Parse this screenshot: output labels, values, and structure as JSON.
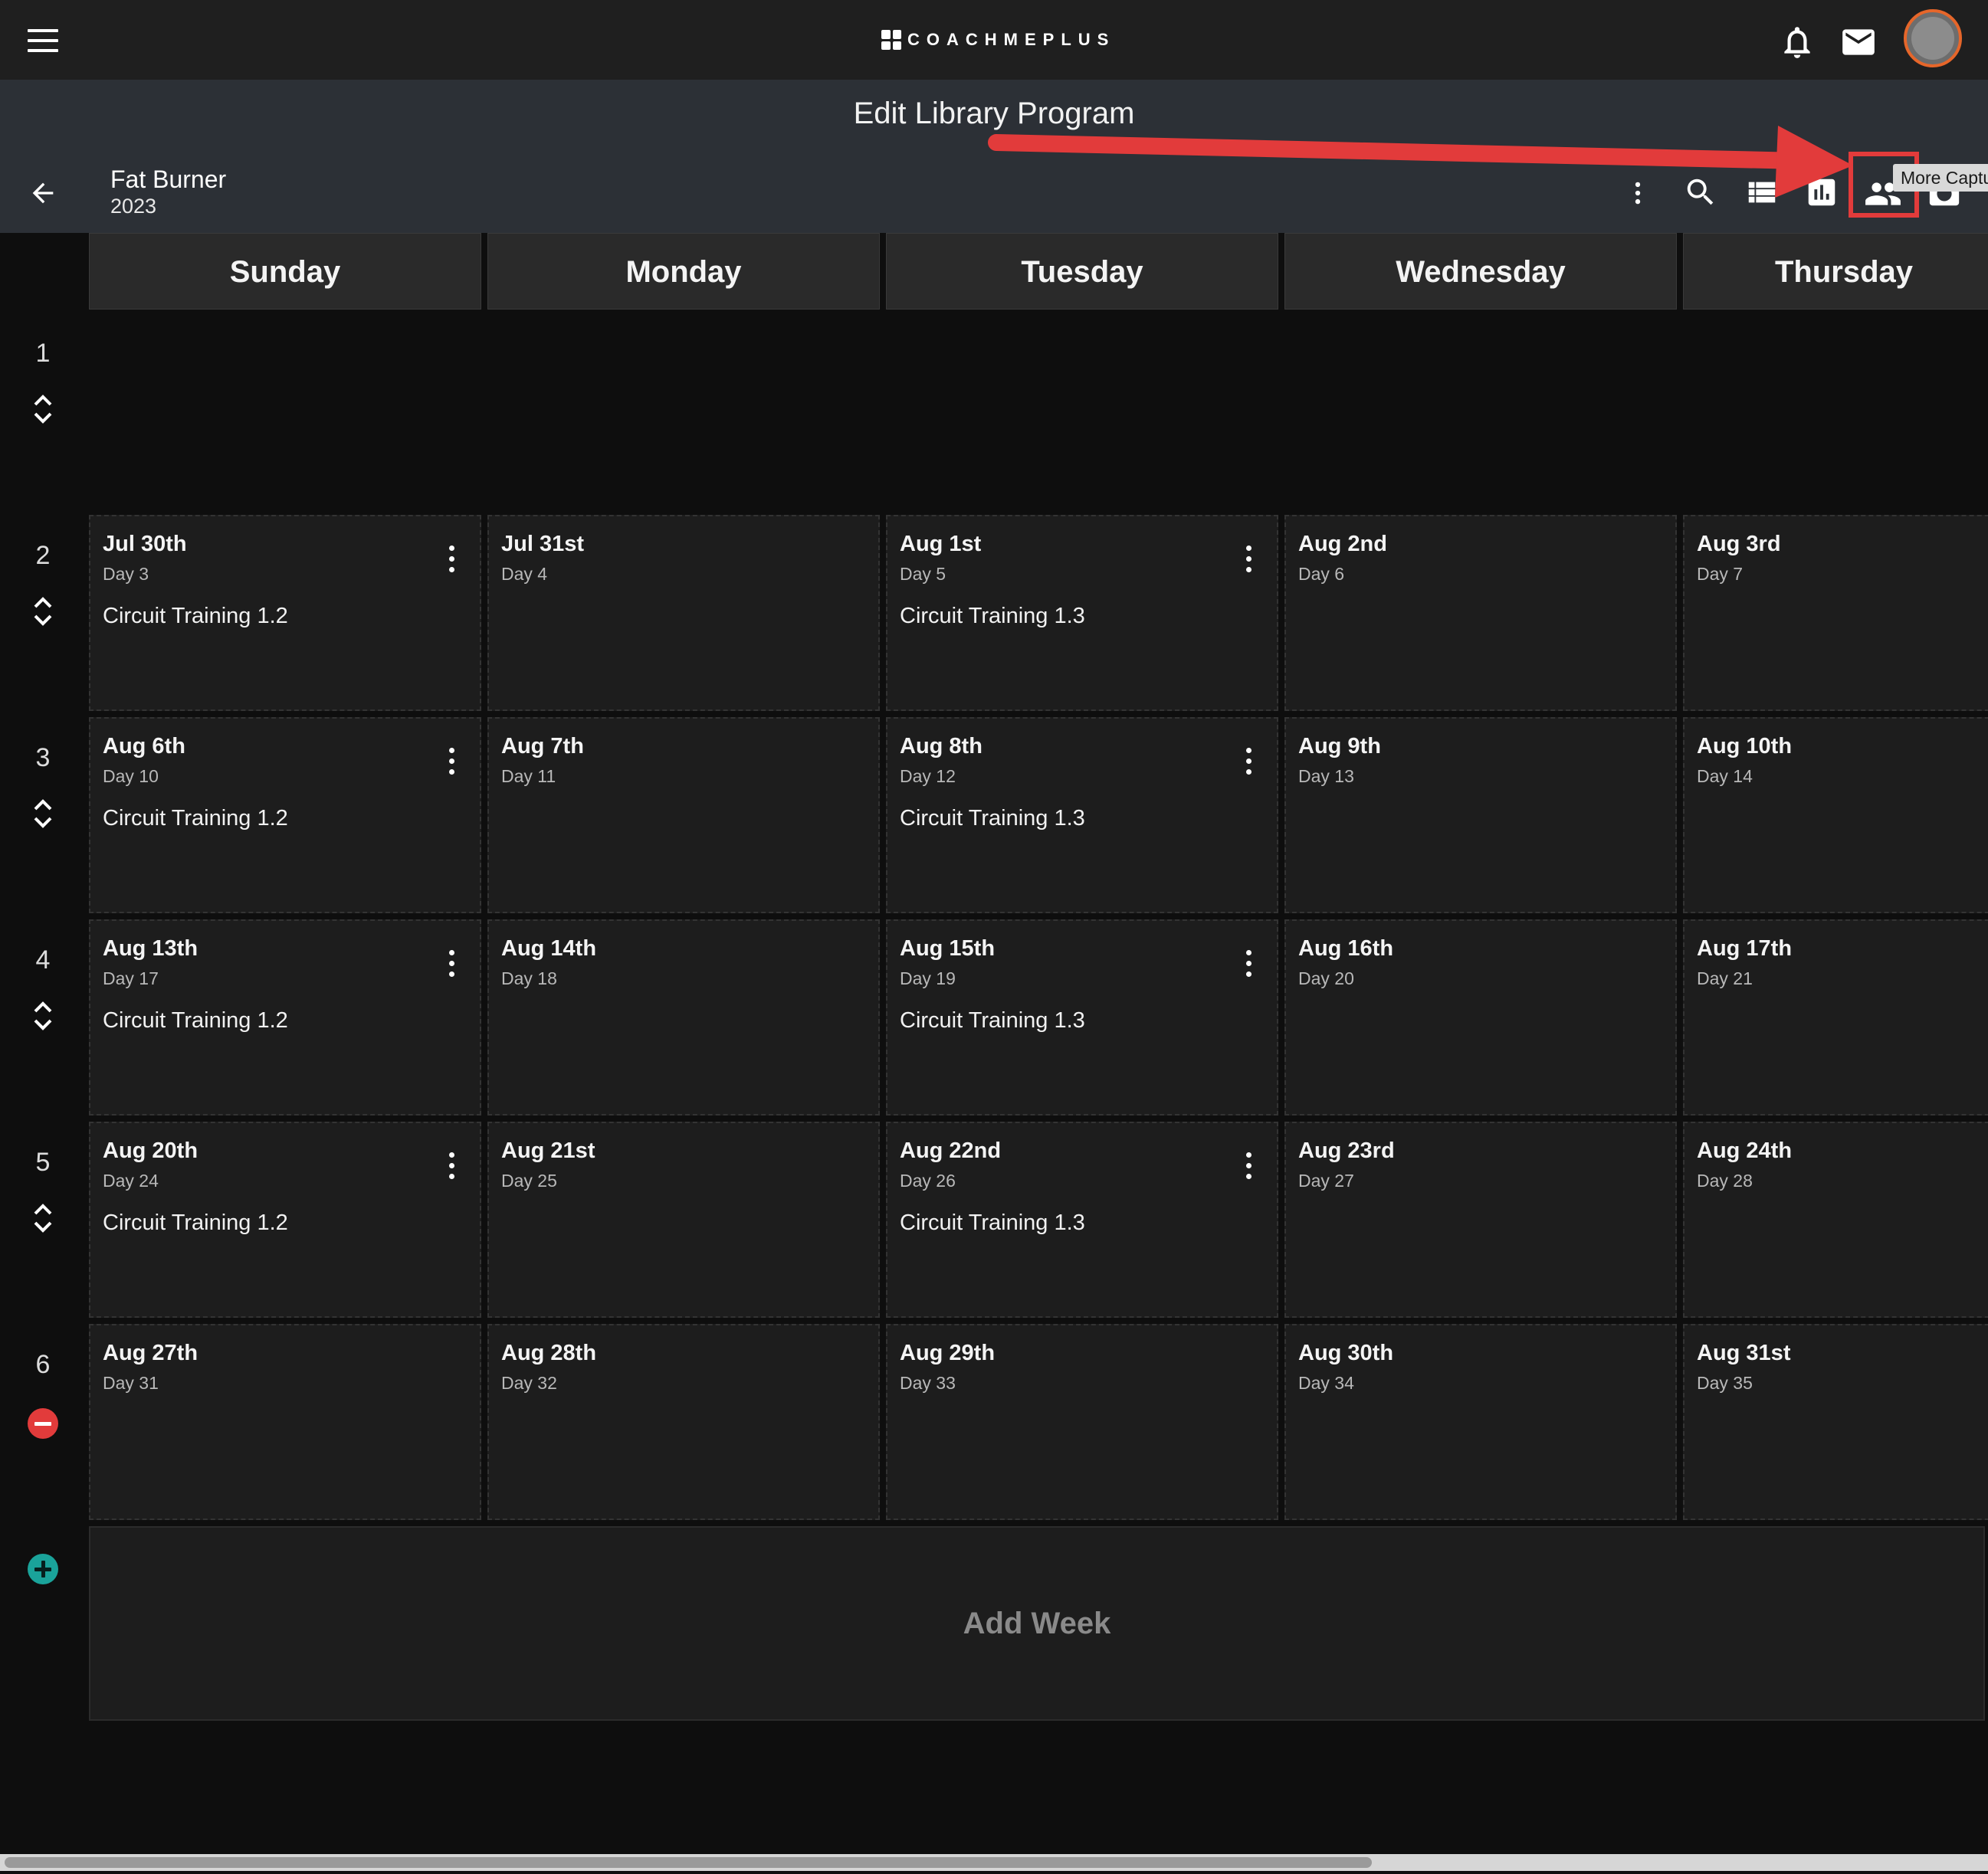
{
  "app": {
    "logo_text": "COACHMEPLUS"
  },
  "header": {
    "page_title": "Edit Library Program"
  },
  "program": {
    "name": "Fat Burner",
    "year": "2023"
  },
  "toolbar": {
    "tooltip": "More Captu"
  },
  "calendar": {
    "days": [
      "Sunday",
      "Monday",
      "Tuesday",
      "Wednesday",
      "Thursday"
    ],
    "weeks": [
      {
        "number": "1",
        "cells": []
      },
      {
        "number": "2",
        "cells": [
          {
            "date": "Jul 30th",
            "day": "Day 3",
            "workout": "Circuit Training 1.2"
          },
          {
            "date": "Jul 31st",
            "day": "Day 4",
            "workout": ""
          },
          {
            "date": "Aug 1st",
            "day": "Day 5",
            "workout": "Circuit Training 1.3"
          },
          {
            "date": "Aug 2nd",
            "day": "Day 6",
            "workout": ""
          },
          {
            "date": "Aug 3rd",
            "day": "Day 7",
            "workout": ""
          }
        ]
      },
      {
        "number": "3",
        "cells": [
          {
            "date": "Aug 6th",
            "day": "Day 10",
            "workout": "Circuit Training 1.2"
          },
          {
            "date": "Aug 7th",
            "day": "Day 11",
            "workout": ""
          },
          {
            "date": "Aug 8th",
            "day": "Day 12",
            "workout": "Circuit Training 1.3"
          },
          {
            "date": "Aug 9th",
            "day": "Day 13",
            "workout": ""
          },
          {
            "date": "Aug 10th",
            "day": "Day 14",
            "workout": ""
          }
        ]
      },
      {
        "number": "4",
        "cells": [
          {
            "date": "Aug 13th",
            "day": "Day 17",
            "workout": "Circuit Training 1.2"
          },
          {
            "date": "Aug 14th",
            "day": "Day 18",
            "workout": ""
          },
          {
            "date": "Aug 15th",
            "day": "Day 19",
            "workout": "Circuit Training 1.3"
          },
          {
            "date": "Aug 16th",
            "day": "Day 20",
            "workout": ""
          },
          {
            "date": "Aug 17th",
            "day": "Day 21",
            "workout": ""
          }
        ]
      },
      {
        "number": "5",
        "cells": [
          {
            "date": "Aug 20th",
            "day": "Day 24",
            "workout": "Circuit Training 1.2"
          },
          {
            "date": "Aug 21st",
            "day": "Day 25",
            "workout": ""
          },
          {
            "date": "Aug 22nd",
            "day": "Day 26",
            "workout": "Circuit Training 1.3"
          },
          {
            "date": "Aug 23rd",
            "day": "Day 27",
            "workout": ""
          },
          {
            "date": "Aug 24th",
            "day": "Day 28",
            "workout": ""
          }
        ]
      },
      {
        "number": "6",
        "cells": [
          {
            "date": "Aug 27th",
            "day": "Day 31",
            "workout": ""
          },
          {
            "date": "Aug 28th",
            "day": "Day 32",
            "workout": ""
          },
          {
            "date": "Aug 29th",
            "day": "Day 33",
            "workout": ""
          },
          {
            "date": "Aug 30th",
            "day": "Day 34",
            "workout": ""
          },
          {
            "date": "Aug 31st",
            "day": "Day 35",
            "workout": ""
          }
        ]
      }
    ],
    "add_week_label": "Add Week"
  },
  "colors": {
    "accent_orange": "#e6662a",
    "annotation_red": "#e23b3b",
    "add_teal": "#1aa39a"
  },
  "icons": [
    "menu-icon",
    "bell-icon",
    "mail-icon",
    "back-arrow-icon",
    "more-vert-icon",
    "search-icon",
    "list-view-icon",
    "bar-chart-icon",
    "people-icon",
    "camera-icon",
    "expand-icon",
    "remove-week-icon",
    "add-week-icon"
  ]
}
